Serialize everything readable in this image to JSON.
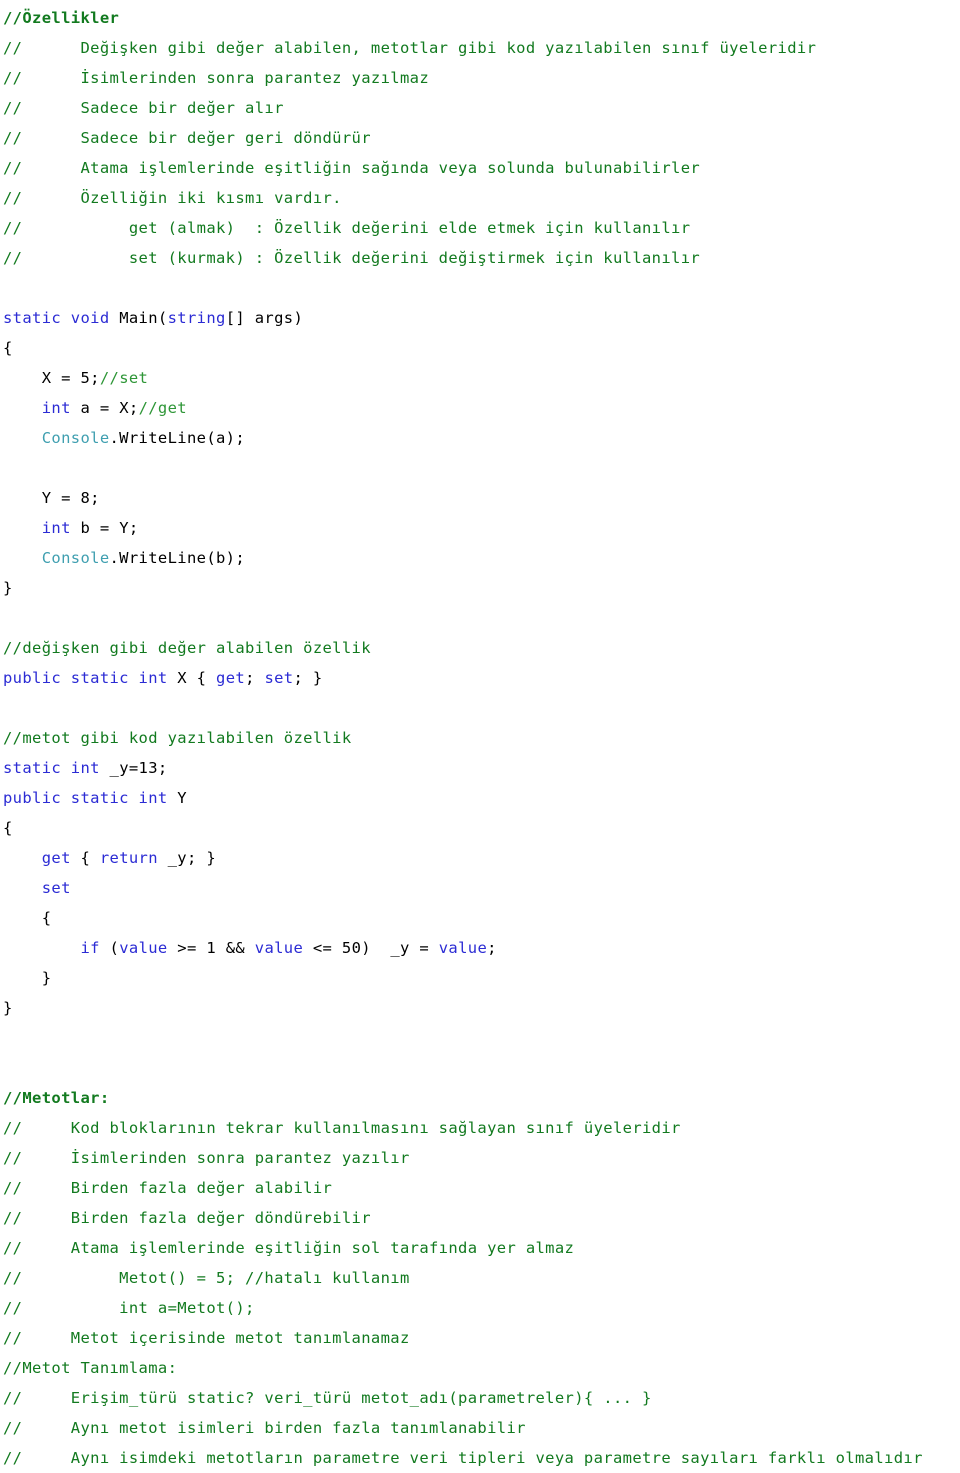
{
  "document": {
    "title": "C# Özellikler ve Metotlar Notları",
    "language": "csharp",
    "background_color": "#ffffff",
    "colors": {
      "comment": "#127a1f",
      "comment_light": "#2e9637",
      "keyword": "#2b2bd4",
      "type": "#3f9fb0",
      "plain": "#000000"
    }
  },
  "lines": [
    {
      "n": 1,
      "tokens": [
        {
          "style": "comment-b",
          "text": "//Özellikler"
        }
      ]
    },
    {
      "n": 2,
      "tokens": [
        {
          "style": "comment",
          "text": "//      Değişken gibi değer alabilen, metotlar gibi kod yazılabilen sınıf üyeleridir"
        }
      ]
    },
    {
      "n": 3,
      "tokens": [
        {
          "style": "comment",
          "text": "//      İsimlerinden sonra parantez yazılmaz"
        }
      ]
    },
    {
      "n": 4,
      "tokens": [
        {
          "style": "comment",
          "text": "//      Sadece bir değer alır"
        }
      ]
    },
    {
      "n": 5,
      "tokens": [
        {
          "style": "comment",
          "text": "//      Sadece bir değer geri döndürür"
        }
      ]
    },
    {
      "n": 6,
      "tokens": [
        {
          "style": "comment",
          "text": "//      Atama işlemlerinde eşitliğin sağında veya solunda bulunabilirler"
        }
      ]
    },
    {
      "n": 7,
      "tokens": [
        {
          "style": "comment",
          "text": "//      Özelliğin iki kısmı vardır."
        }
      ]
    },
    {
      "n": 8,
      "tokens": [
        {
          "style": "comment",
          "text": "//           get (almak)  : Özellik değerini elde etmek için kullanılır"
        }
      ]
    },
    {
      "n": 9,
      "tokens": [
        {
          "style": "comment",
          "text": "//           set (kurmak) : Özellik değerini değiştirmek için kullanılır"
        }
      ]
    },
    {
      "n": 10,
      "tokens": []
    },
    {
      "n": 11,
      "tokens": [
        {
          "style": "keyword",
          "text": "static"
        },
        {
          "style": "plain",
          "text": " "
        },
        {
          "style": "keyword",
          "text": "void"
        },
        {
          "style": "plain",
          "text": " Main("
        },
        {
          "style": "keyword",
          "text": "string"
        },
        {
          "style": "plain",
          "text": "[] args)"
        }
      ]
    },
    {
      "n": 12,
      "tokens": [
        {
          "style": "plain",
          "text": "{"
        }
      ]
    },
    {
      "n": 13,
      "tokens": [
        {
          "style": "plain",
          "text": "    X = 5;"
        },
        {
          "style": "comment-l",
          "text": "//set"
        }
      ]
    },
    {
      "n": 14,
      "tokens": [
        {
          "style": "keyword",
          "text": "    int"
        },
        {
          "style": "plain",
          "text": " a = X;"
        },
        {
          "style": "comment-l",
          "text": "//get"
        }
      ]
    },
    {
      "n": 15,
      "tokens": [
        {
          "style": "type",
          "text": "    Console"
        },
        {
          "style": "plain",
          "text": ".WriteLine(a);"
        }
      ]
    },
    {
      "n": 16,
      "tokens": []
    },
    {
      "n": 17,
      "tokens": [
        {
          "style": "plain",
          "text": "    Y = 8;"
        }
      ]
    },
    {
      "n": 18,
      "tokens": [
        {
          "style": "keyword",
          "text": "    int"
        },
        {
          "style": "plain",
          "text": " b = Y;"
        }
      ]
    },
    {
      "n": 19,
      "tokens": [
        {
          "style": "type",
          "text": "    Console"
        },
        {
          "style": "plain",
          "text": ".WriteLine(b);"
        }
      ]
    },
    {
      "n": 20,
      "tokens": [
        {
          "style": "plain",
          "text": "}"
        }
      ]
    },
    {
      "n": 21,
      "tokens": []
    },
    {
      "n": 22,
      "tokens": [
        {
          "style": "comment",
          "text": "//değişken gibi değer alabilen özellik"
        }
      ]
    },
    {
      "n": 23,
      "tokens": [
        {
          "style": "keyword",
          "text": "public static int"
        },
        {
          "style": "plain",
          "text": " X { "
        },
        {
          "style": "keyword",
          "text": "get"
        },
        {
          "style": "plain",
          "text": "; "
        },
        {
          "style": "keyword",
          "text": "set"
        },
        {
          "style": "plain",
          "text": "; }"
        }
      ]
    },
    {
      "n": 24,
      "tokens": []
    },
    {
      "n": 25,
      "tokens": [
        {
          "style": "comment",
          "text": "//metot gibi kod yazılabilen özellik"
        }
      ]
    },
    {
      "n": 26,
      "tokens": [
        {
          "style": "keyword",
          "text": "static int"
        },
        {
          "style": "plain",
          "text": " _y=13;"
        }
      ]
    },
    {
      "n": 27,
      "tokens": [
        {
          "style": "keyword",
          "text": "public static int"
        },
        {
          "style": "plain",
          "text": " Y"
        }
      ]
    },
    {
      "n": 28,
      "tokens": [
        {
          "style": "plain",
          "text": "{"
        }
      ]
    },
    {
      "n": 29,
      "tokens": [
        {
          "style": "keyword",
          "text": "    get"
        },
        {
          "style": "plain",
          "text": " { "
        },
        {
          "style": "keyword",
          "text": "return"
        },
        {
          "style": "plain",
          "text": " _y; }"
        }
      ]
    },
    {
      "n": 30,
      "tokens": [
        {
          "style": "keyword",
          "text": "    set"
        }
      ]
    },
    {
      "n": 31,
      "tokens": [
        {
          "style": "plain",
          "text": "    {"
        }
      ]
    },
    {
      "n": 32,
      "tokens": [
        {
          "style": "keyword",
          "text": "        if"
        },
        {
          "style": "plain",
          "text": " ("
        },
        {
          "style": "keyword",
          "text": "value"
        },
        {
          "style": "plain",
          "text": " >= 1 && "
        },
        {
          "style": "keyword",
          "text": "value"
        },
        {
          "style": "plain",
          "text": " <= 50)  _y = "
        },
        {
          "style": "keyword",
          "text": "value"
        },
        {
          "style": "plain",
          "text": ";"
        }
      ]
    },
    {
      "n": 33,
      "tokens": [
        {
          "style": "plain",
          "text": "    }"
        }
      ]
    },
    {
      "n": 34,
      "tokens": [
        {
          "style": "plain",
          "text": "}"
        }
      ]
    },
    {
      "n": 35,
      "tokens": []
    },
    {
      "n": 36,
      "tokens": []
    },
    {
      "n": 37,
      "tokens": [
        {
          "style": "comment-b",
          "text": "//Metotlar:"
        }
      ]
    },
    {
      "n": 38,
      "tokens": [
        {
          "style": "comment",
          "text": "//     Kod bloklarının tekrar kullanılmasını sağlayan sınıf üyeleridir"
        }
      ]
    },
    {
      "n": 39,
      "tokens": [
        {
          "style": "comment",
          "text": "//     İsimlerinden sonra parantez yazılır"
        }
      ]
    },
    {
      "n": 40,
      "tokens": [
        {
          "style": "comment",
          "text": "//     Birden fazla değer alabilir"
        }
      ]
    },
    {
      "n": 41,
      "tokens": [
        {
          "style": "comment",
          "text": "//     Birden fazla değer döndürebilir"
        }
      ]
    },
    {
      "n": 42,
      "tokens": [
        {
          "style": "comment",
          "text": "//     Atama işlemlerinde eşitliğin sol tarafında yer almaz"
        }
      ]
    },
    {
      "n": 43,
      "tokens": [
        {
          "style": "comment",
          "text": "//          Metot() = 5; //hatalı kullanım"
        }
      ]
    },
    {
      "n": 44,
      "tokens": [
        {
          "style": "comment",
          "text": "//          int a=Metot();"
        }
      ]
    },
    {
      "n": 45,
      "tokens": [
        {
          "style": "comment",
          "text": "//     Metot içerisinde metot tanımlanamaz"
        }
      ]
    },
    {
      "n": 46,
      "tokens": [
        {
          "style": "comment",
          "text": "//Metot Tanımlama:"
        }
      ]
    },
    {
      "n": 47,
      "tokens": [
        {
          "style": "comment",
          "text": "//     Erişim_türü static? veri_türü metot_adı(parametreler){ ... }"
        }
      ]
    },
    {
      "n": 48,
      "tokens": [
        {
          "style": "comment",
          "text": "//     Aynı metot isimleri birden fazla tanımlanabilir"
        }
      ]
    },
    {
      "n": 49,
      "tokens": [
        {
          "style": "comment",
          "text": "//     Aynı isimdeki metotların parametre veri tipleri veya parametre sayıları farklı olmalıdır"
        }
      ]
    }
  ]
}
